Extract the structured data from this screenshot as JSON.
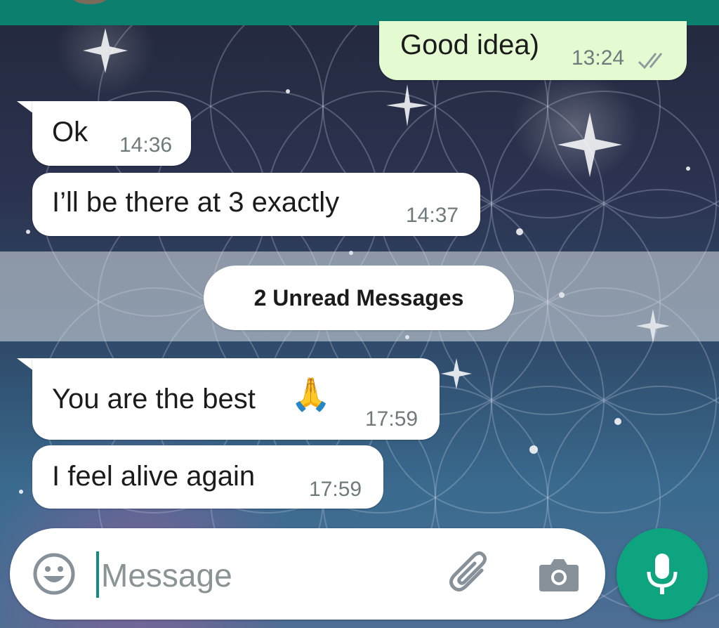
{
  "messages": [
    {
      "direction": "out",
      "text": "Good idea)",
      "time": "13:24",
      "status": "read"
    },
    {
      "direction": "in",
      "text": "Ok",
      "time": "14:36"
    },
    {
      "direction": "in",
      "text": "I’ll be there at 3 exactly",
      "time": "14:37"
    },
    {
      "direction": "in",
      "text": "You are the best",
      "emoji": "🙏",
      "time": "17:59"
    },
    {
      "direction": "in",
      "text": "I feel alive again",
      "time": "17:59"
    }
  ],
  "unread_divider": {
    "label": "2 Unread Messages"
  },
  "composer": {
    "placeholder": "Message",
    "icons": [
      "emoji-icon",
      "attach-icon",
      "camera-icon"
    ],
    "send_button_icon": "mic-icon"
  },
  "colors": {
    "header": "#0b806e",
    "incoming_bubble": "#ffffff",
    "outgoing_bubble": "#e4fbd1",
    "mic_button": "#0ea47f",
    "caret": "#128c7e"
  }
}
